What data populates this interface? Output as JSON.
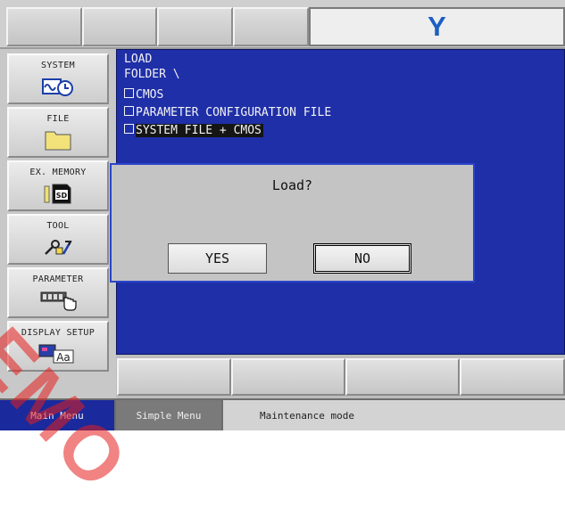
{
  "header": {
    "logo_text": "Y",
    "logo_color": "#1b5fc2"
  },
  "sidebar": {
    "items": [
      {
        "label": "SYSTEM",
        "icon": "system-clock-icon"
      },
      {
        "label": "FILE",
        "icon": "folder-icon"
      },
      {
        "label": "EX. MEMORY",
        "icon": "sd-card-icon"
      },
      {
        "label": "TOOL",
        "icon": "tools-icon"
      },
      {
        "label": "PARAMETER",
        "icon": "parameter-hand-icon"
      },
      {
        "label": "DISPLAY SETUP",
        "icon": "display-aa-icon"
      }
    ]
  },
  "main": {
    "title": "LOAD",
    "path": "FOLDER \\",
    "options": [
      {
        "label": "CMOS",
        "selected": false
      },
      {
        "label": "PARAMETER CONFIGURATION FILE",
        "selected": false
      },
      {
        "label": "SYSTEM FILE + CMOS",
        "selected": true
      }
    ]
  },
  "dialog": {
    "message": "Load?",
    "yes_label": "YES",
    "no_label": "NO"
  },
  "footer": {
    "main_menu": "Main Menu",
    "simple_menu": "Simple Menu",
    "mode": "Maintenance mode"
  },
  "watermark": {
    "text": "DEMO",
    "color": "#e61e1e"
  },
  "colors": {
    "pane_blue": "#1f2fa8",
    "dialog_border": "#2b44c9",
    "main_menu_bg": "#1a2a9c"
  }
}
